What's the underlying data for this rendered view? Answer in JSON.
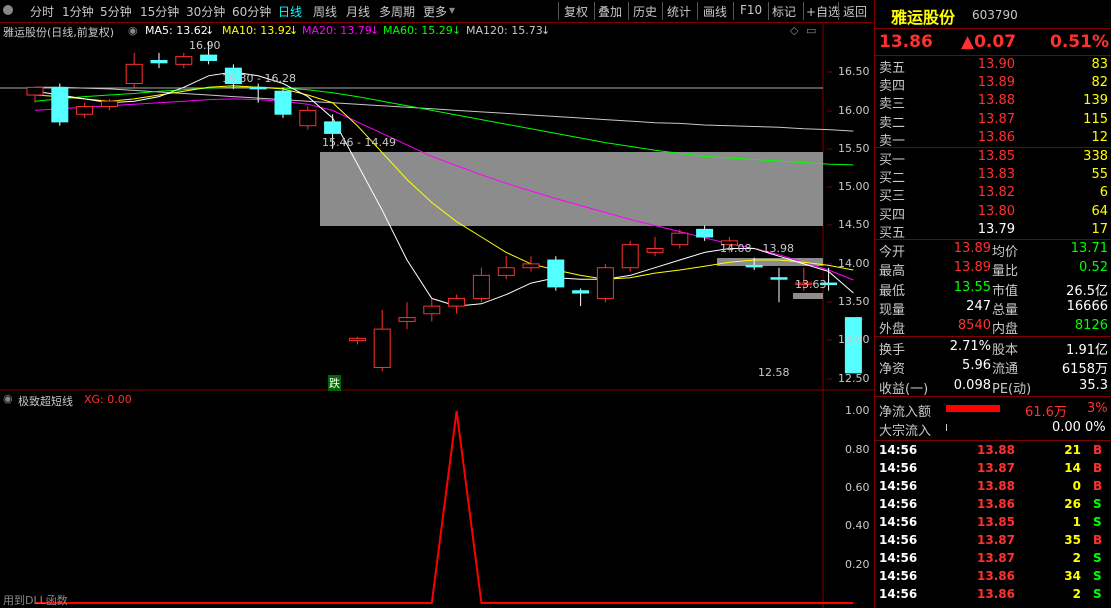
{
  "toolbar": {
    "periods": [
      "分时",
      "1分钟",
      "5分钟",
      "15分钟",
      "30分钟",
      "60分钟",
      "日线",
      "周线",
      "月线",
      "多周期",
      "更多"
    ],
    "active": "日线",
    "actions": [
      "复权",
      "叠加",
      "历史",
      "统计",
      "画线",
      "F10",
      "标记",
      "+自选",
      "返回"
    ]
  },
  "chart_info": {
    "title": "雅运股份(日线,前复权)",
    "ma": [
      {
        "label": "MA5: 13.62",
        "color": "#ffffff"
      },
      {
        "label": "MA10: 13.92",
        "color": "#ffff00"
      },
      {
        "label": "MA20: 13.79",
        "color": "#ff00ff"
      },
      {
        "label": "MA60: 15.29",
        "color": "#00ff00"
      },
      {
        "label": "MA120: 15.73",
        "color": "#c8c8c8"
      }
    ]
  },
  "yaxis": [
    "16.50",
    "16.00",
    "15.50",
    "15.00",
    "14.50",
    "14.00",
    "13.50",
    "13.00",
    "12.50"
  ],
  "annotations": {
    "high": "16.90",
    "range1": "16.30 - 16.28",
    "range2": "15.46 - 14.49",
    "range3": "14.08 - 13.98",
    "last": "13.63",
    "low": "12.58",
    "signal": "跌"
  },
  "indicator": {
    "title": "极致超短线",
    "xg": "XG: 0.00",
    "yaxis": [
      "1.00",
      "0.80",
      "0.60",
      "0.40",
      "0.20"
    ],
    "footer": "用到DLL函数"
  },
  "quote": {
    "name": "雅运股份",
    "code": "603790",
    "price": "13.86",
    "change": "▲0.07",
    "pct": "0.51%"
  },
  "orderbook": {
    "asks": [
      {
        "label": "卖五",
        "price": "13.90",
        "vol": "83"
      },
      {
        "label": "卖四",
        "price": "13.89",
        "vol": "82"
      },
      {
        "label": "卖三",
        "price": "13.88",
        "vol": "139"
      },
      {
        "label": "卖二",
        "price": "13.87",
        "vol": "115"
      },
      {
        "label": "卖一",
        "price": "13.86",
        "vol": "12"
      }
    ],
    "bids": [
      {
        "label": "买一",
        "price": "13.85",
        "vol": "338"
      },
      {
        "label": "买二",
        "price": "13.83",
        "vol": "55"
      },
      {
        "label": "买三",
        "price": "13.82",
        "vol": "6"
      },
      {
        "label": "买四",
        "price": "13.80",
        "vol": "64"
      },
      {
        "label": "买五",
        "price": "13.79",
        "vol": "17"
      }
    ]
  },
  "stats": [
    [
      {
        "k": "今开",
        "v": "13.89"
      },
      {
        "k": "均价",
        "v": "13.71"
      }
    ],
    [
      {
        "k": "最高",
        "v": "13.89"
      },
      {
        "k": "量比",
        "v": "0.52"
      }
    ],
    [
      {
        "k": "最低",
        "v": "13.55"
      },
      {
        "k": "市值",
        "v": "26.5亿"
      }
    ],
    [
      {
        "k": "现量",
        "v": "247"
      },
      {
        "k": "总量",
        "v": "16666"
      }
    ],
    [
      {
        "k": "外盘",
        "v": "8540"
      },
      {
        "k": "内盘",
        "v": "8126"
      }
    ]
  ],
  "stats2": [
    [
      {
        "k": "换手",
        "v": "2.71%"
      },
      {
        "k": "股本",
        "v": "1.91亿"
      }
    ],
    [
      {
        "k": "净资",
        "v": "5.96"
      },
      {
        "k": "流通",
        "v": "6158万"
      }
    ],
    [
      {
        "k": "收益(一)",
        "v": "0.098"
      },
      {
        "k": "PE(动)",
        "v": "35.3"
      }
    ]
  ],
  "flow": [
    {
      "k": "净流入额",
      "v": "61.6万",
      "p": "3%"
    },
    {
      "k": "大宗流入",
      "v": "0.00",
      "p": "0%"
    }
  ],
  "trades": [
    {
      "t": "14:56",
      "p": "13.88",
      "v": "21",
      "s": "B"
    },
    {
      "t": "14:56",
      "p": "13.87",
      "v": "14",
      "s": "B"
    },
    {
      "t": "14:56",
      "p": "13.88",
      "v": "0",
      "s": "B"
    },
    {
      "t": "14:56",
      "p": "13.86",
      "v": "26",
      "s": "S"
    },
    {
      "t": "14:56",
      "p": "13.85",
      "v": "1",
      "s": "S"
    },
    {
      "t": "14:56",
      "p": "13.87",
      "v": "35",
      "s": "B"
    },
    {
      "t": "14:56",
      "p": "13.87",
      "v": "2",
      "s": "S"
    },
    {
      "t": "14:56",
      "p": "13.86",
      "v": "34",
      "s": "S"
    },
    {
      "t": "14:56",
      "p": "13.86",
      "v": "2",
      "s": "S"
    }
  ],
  "candles": [
    {
      "o": 16.2,
      "c": 16.3,
      "h": 16.3,
      "l": 16.1
    },
    {
      "o": 16.3,
      "c": 15.85,
      "h": 16.35,
      "l": 15.8
    },
    {
      "o": 15.95,
      "c": 16.05,
      "h": 16.1,
      "l": 15.9
    },
    {
      "o": 16.05,
      "c": 16.12,
      "h": 16.15,
      "l": 16.0
    },
    {
      "o": 16.35,
      "c": 16.6,
      "h": 16.75,
      "l": 16.3
    },
    {
      "o": 16.65,
      "c": 16.62,
      "h": 16.75,
      "l": 16.55
    },
    {
      "o": 16.6,
      "c": 16.7,
      "h": 16.75,
      "l": 16.55
    },
    {
      "o": 16.72,
      "c": 16.65,
      "h": 16.9,
      "l": 16.6
    },
    {
      "o": 16.55,
      "c": 16.35,
      "h": 16.6,
      "l": 16.28
    },
    {
      "o": 16.3,
      "c": 16.28,
      "h": 16.35,
      "l": 16.1
    },
    {
      "o": 16.25,
      "c": 15.95,
      "h": 16.3,
      "l": 15.9
    },
    {
      "o": 15.8,
      "c": 16.0,
      "h": 16.05,
      "l": 15.75
    },
    {
      "o": 15.85,
      "c": 15.7,
      "h": 15.95,
      "l": 15.5
    },
    {
      "o": 13.0,
      "c": 13.03,
      "h": 13.05,
      "l": 12.95
    },
    {
      "o": 12.65,
      "c": 13.15,
      "h": 13.4,
      "l": 12.6
    },
    {
      "o": 13.25,
      "c": 13.3,
      "h": 13.5,
      "l": 13.15
    },
    {
      "o": 13.35,
      "c": 13.45,
      "h": 13.55,
      "l": 13.25
    },
    {
      "o": 13.45,
      "c": 13.55,
      "h": 13.6,
      "l": 13.35
    },
    {
      "o": 13.55,
      "c": 13.85,
      "h": 13.95,
      "l": 13.5
    },
    {
      "o": 13.85,
      "c": 13.95,
      "h": 14.1,
      "l": 13.8
    },
    {
      "o": 13.95,
      "c": 14.0,
      "h": 14.1,
      "l": 13.9
    },
    {
      "o": 14.05,
      "c": 13.7,
      "h": 14.1,
      "l": 13.65
    },
    {
      "o": 13.65,
      "c": 13.62,
      "h": 13.68,
      "l": 13.45
    },
    {
      "o": 13.55,
      "c": 13.95,
      "h": 14.0,
      "l": 13.5
    },
    {
      "o": 13.95,
      "c": 14.25,
      "h": 14.3,
      "l": 13.9
    },
    {
      "o": 14.15,
      "c": 14.2,
      "h": 14.35,
      "l": 14.1
    },
    {
      "o": 14.25,
      "c": 14.4,
      "h": 14.45,
      "l": 14.2
    },
    {
      "o": 14.45,
      "c": 14.35,
      "h": 14.5,
      "l": 14.3
    },
    {
      "o": 14.25,
      "c": 14.3,
      "h": 14.35,
      "l": 14.15
    },
    {
      "o": 13.98,
      "c": 13.97,
      "h": 14.08,
      "l": 13.92
    },
    {
      "o": 13.82,
      "c": 13.8,
      "h": 13.95,
      "l": 13.5
    },
    {
      "o": 13.75,
      "c": 13.75,
      "h": 13.95,
      "l": 13.65
    },
    {
      "o": 13.75,
      "c": 13.73,
      "h": 13.95,
      "l": 13.65
    },
    {
      "o": 13.3,
      "c": 12.58,
      "h": 13.3,
      "l": 12.58
    }
  ],
  "ma_series": {
    "ma5": [
      16.25,
      16.2,
      16.15,
      16.1,
      16.12,
      16.18,
      16.3,
      16.45,
      16.5,
      16.45,
      16.35,
      16.18,
      15.9,
      15.3,
      14.7,
      14.05,
      13.55,
      13.45,
      13.48,
      13.6,
      13.75,
      13.82,
      13.8,
      13.8,
      13.85,
      13.95,
      14.05,
      14.15,
      14.2,
      14.2,
      14.1,
      14.0,
      13.9,
      13.62
    ],
    "ma10": [
      16.2,
      16.18,
      16.15,
      16.12,
      16.15,
      16.2,
      16.25,
      16.3,
      16.32,
      16.3,
      16.28,
      16.2,
      16.1,
      15.8,
      15.45,
      15.1,
      14.8,
      14.55,
      14.35,
      14.15,
      14.0,
      13.92,
      13.85,
      13.8,
      13.82,
      13.88,
      13.92,
      13.97,
      14.02,
      14.05,
      14.05,
      14.02,
      13.98,
      13.92
    ],
    "ma20": [
      16.0,
      16.02,
      16.04,
      16.06,
      16.08,
      16.1,
      16.12,
      16.14,
      16.15,
      16.14,
      16.12,
      16.08,
      16.0,
      15.85,
      15.7,
      15.55,
      15.4,
      15.28,
      15.16,
      15.05,
      14.95,
      14.85,
      14.76,
      14.67,
      14.58,
      14.5,
      14.42,
      14.34,
      14.26,
      14.2,
      14.12,
      14.02,
      13.92,
      13.79
    ],
    "ma60": [
      16.12,
      16.15,
      16.18,
      16.2,
      16.22,
      16.25,
      16.27,
      16.29,
      16.3,
      16.3,
      16.29,
      16.27,
      16.23,
      16.18,
      16.12,
      16.06,
      16.0,
      15.94,
      15.88,
      15.82,
      15.76,
      15.7,
      15.64,
      15.58,
      15.53,
      15.48,
      15.44,
      15.4,
      15.38,
      15.36,
      15.34,
      15.32,
      15.3,
      15.29
    ],
    "ma120": [
      16.3,
      16.3,
      16.29,
      16.28,
      16.26,
      16.24,
      16.22,
      16.2,
      16.18,
      16.16,
      16.14,
      16.12,
      16.1,
      16.08,
      16.06,
      16.04,
      16.02,
      16.0,
      15.98,
      15.96,
      15.94,
      15.92,
      15.9,
      15.88,
      15.86,
      15.84,
      15.83,
      15.81,
      15.8,
      15.79,
      15.78,
      15.76,
      15.75,
      15.73
    ]
  },
  "xg_series": [
    0,
    0,
    0,
    0,
    0,
    0,
    0,
    0,
    0,
    0,
    0,
    0,
    0,
    0,
    0,
    0,
    0,
    1,
    0,
    0,
    0,
    0,
    0,
    0,
    0,
    0,
    0,
    0,
    0,
    0,
    0,
    0,
    0,
    0
  ]
}
